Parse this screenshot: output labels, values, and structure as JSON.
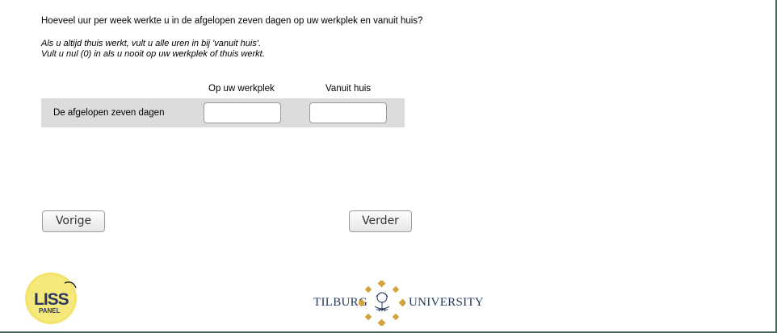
{
  "question": "Hoeveel uur per week werkte u in de afgelopen zeven dagen op uw werkplek en vanuit huis?",
  "instructions": {
    "line1": "Als u altijd thuis werkt, vult u alle uren in bij 'vanuit huis'.",
    "line2": "Vult u nul (0) in als u nooit op uw werkplek of thuis werkt."
  },
  "table": {
    "columns": [
      "Op uw werkplek",
      "Vanuit huis"
    ],
    "rows": [
      {
        "label": "De afgelopen zeven dagen",
        "werkplek": "",
        "huis": ""
      }
    ]
  },
  "buttons": {
    "previous": "Vorige",
    "next": "Verder"
  },
  "logos": {
    "liss": {
      "top": "LISS",
      "bottom": "PANEL",
      "color": "#f3e36a"
    },
    "tilburg": {
      "left": "TILBURG",
      "right": "UNIVERSITY",
      "color": "#1f3558",
      "accent": "#d4a23a"
    }
  },
  "colors": {
    "row_background": "#dcdcdc",
    "frame_border": "#4a6a5a"
  }
}
